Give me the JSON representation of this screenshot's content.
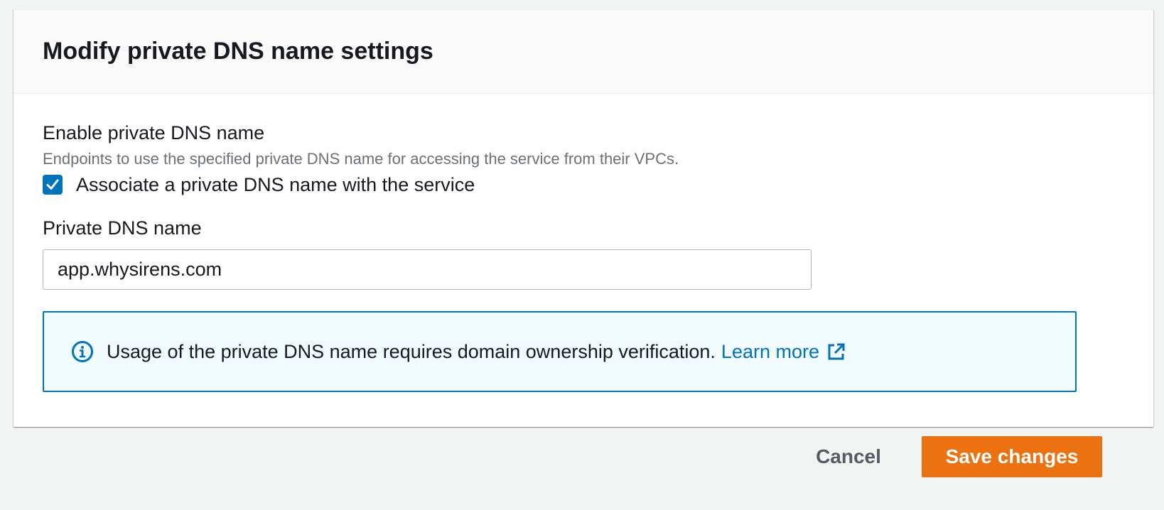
{
  "panel": {
    "title": "Modify private DNS name settings"
  },
  "enable_section": {
    "label": "Enable private DNS name",
    "description": "Endpoints to use the specified private DNS name for accessing the service from their VPCs.",
    "checkbox_label": "Associate a private DNS name with the service",
    "checkbox_checked": true
  },
  "dns_field": {
    "label": "Private DNS name",
    "value": "app.whysirens.com"
  },
  "info_alert": {
    "icon": "info-icon",
    "message": "Usage of the private DNS name requires domain ownership verification.",
    "link_label": "Learn more",
    "link_icon": "external-link-icon"
  },
  "actions": {
    "cancel_label": "Cancel",
    "save_label": "Save changes"
  },
  "colors": {
    "accent": "#0073bb",
    "primary_button": "#ec7211",
    "info_background": "#f1faff",
    "page_background": "#f2f3f3"
  }
}
